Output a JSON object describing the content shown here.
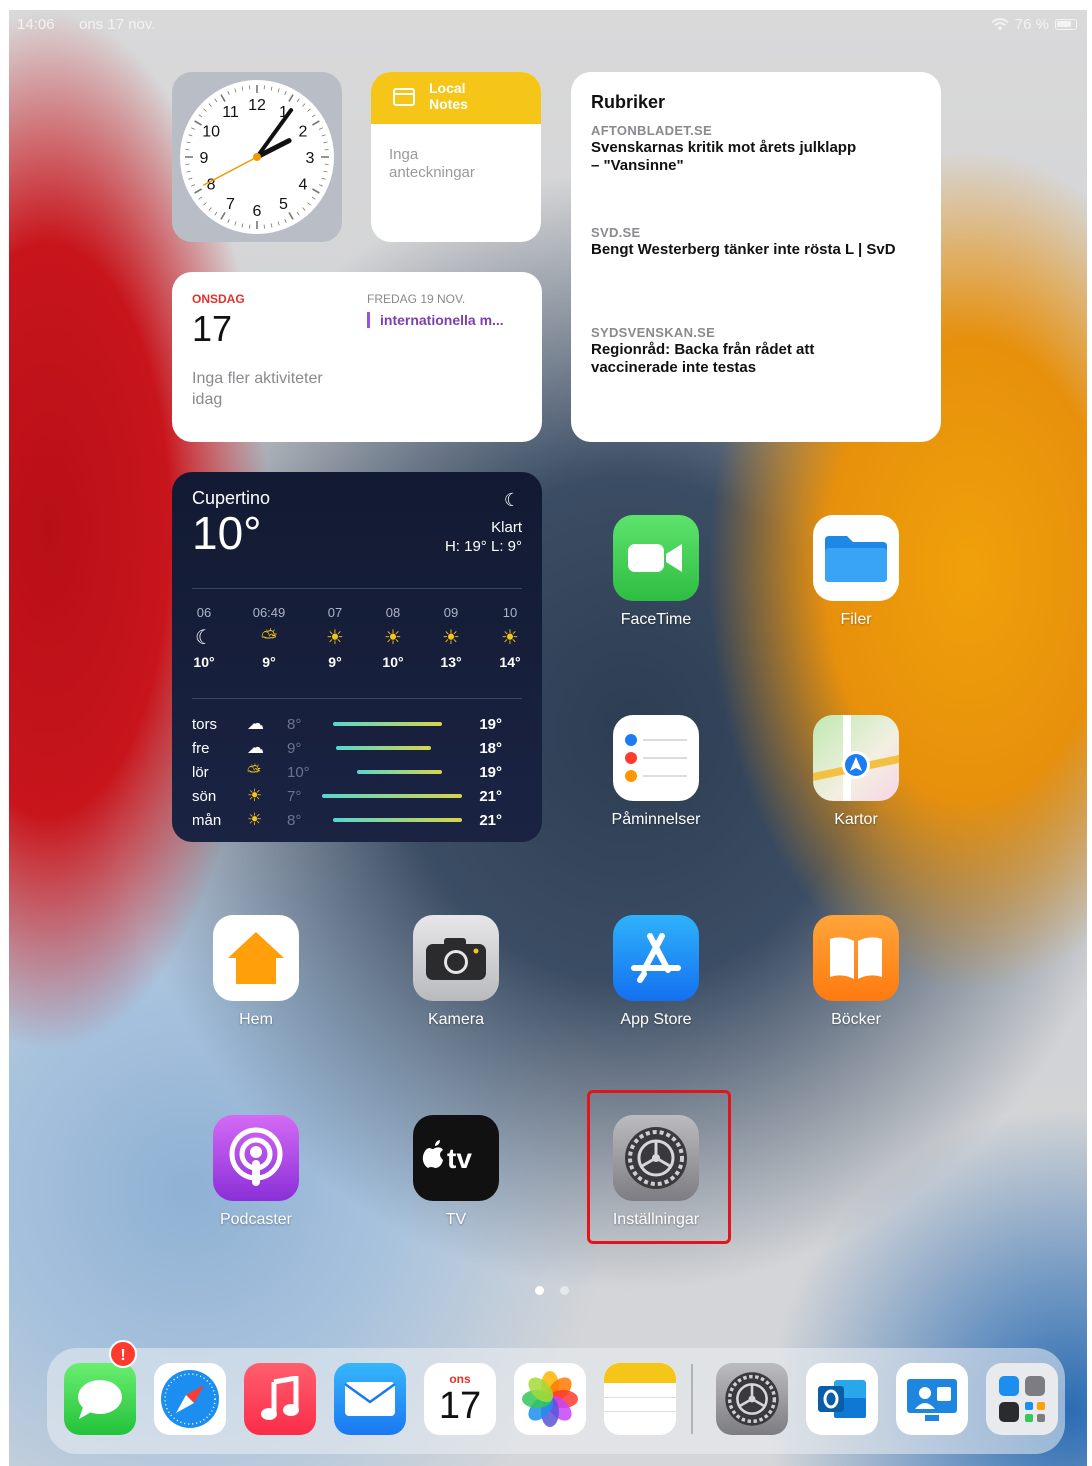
{
  "status_bar": {
    "time": "14:06",
    "date": "ons 17 nov.",
    "battery": "76 %"
  },
  "clock_widget": {
    "numbers": [
      "12",
      "1",
      "2",
      "3",
      "4",
      "5",
      "6",
      "7",
      "8",
      "9",
      "10",
      "11"
    ],
    "hour": 2,
    "minute": 6
  },
  "notes_widget": {
    "title_line1": "Local",
    "title_line2": "Notes",
    "empty_line1": "Inga",
    "empty_line2": "anteckningar"
  },
  "news_widget": {
    "title": "Rubriker",
    "items": [
      {
        "source": "AFTONBLADET.SE",
        "headline1": "Svenskarnas kritik mot årets julklapp",
        "headline2": "– \"Vansinne\""
      },
      {
        "source": "SVD.SE",
        "headline1": "Bengt Westerberg tänker inte rösta L | SvD",
        "headline2": ""
      },
      {
        "source": "SYDSVENSKAN.SE",
        "headline1": "Regionråd: Backa från rådet att",
        "headline2": "vaccinerade inte testas"
      }
    ]
  },
  "calendar_widget": {
    "weekday": "ONSDAG",
    "day": "17",
    "no_events_line1": "Inga fler aktiviteter",
    "no_events_line2": "idag",
    "next_date": "FREDAG 19 NOV.",
    "next_event": "internationella m..."
  },
  "weather_widget": {
    "city": "Cupertino",
    "temp": "10°",
    "condition": "Klart",
    "hilo": "H: 19° L: 9°",
    "hourly": [
      {
        "hour": "06",
        "icon": "moon-icon",
        "temp": "10°"
      },
      {
        "hour": "06:49",
        "icon": "sunrise-icon",
        "temp": "9°"
      },
      {
        "hour": "07",
        "icon": "sun-icon",
        "temp": "9°"
      },
      {
        "hour": "08",
        "icon": "sun-icon",
        "temp": "10°"
      },
      {
        "hour": "09",
        "icon": "sun-icon",
        "temp": "13°"
      },
      {
        "hour": "10",
        "icon": "sun-icon",
        "temp": "14°"
      }
    ],
    "daily": [
      {
        "day": "tors",
        "icon": "cloud-icon",
        "low": "8°",
        "high": "19°",
        "bar_from": 0.08,
        "bar_to": 0.86
      },
      {
        "day": "fre",
        "icon": "cloud-icon",
        "low": "9°",
        "high": "18°",
        "bar_from": 0.1,
        "bar_to": 0.78
      },
      {
        "day": "lör",
        "icon": "partly-cloudy-icon",
        "low": "10°",
        "high": "19°",
        "bar_from": 0.25,
        "bar_to": 0.86
      },
      {
        "day": "sön",
        "icon": "sun-icon",
        "low": "7°",
        "high": "21°",
        "bar_from": 0.0,
        "bar_to": 1.0
      },
      {
        "day": "mån",
        "icon": "sun-icon",
        "low": "8°",
        "high": "21°",
        "bar_from": 0.08,
        "bar_to": 1.0
      }
    ]
  },
  "apps": {
    "facetime": "FaceTime",
    "filer": "Filer",
    "paminnelser": "Påminnelser",
    "kartor": "Kartor",
    "hem": "Hem",
    "kamera": "Kamera",
    "appstore": "App Store",
    "bocker": "Böcker",
    "podcaster": "Podcaster",
    "tv": "TV",
    "installningar": "Inställningar"
  },
  "dock": {
    "messages_badge": "!",
    "calendar_weekday": "ons",
    "calendar_day": "17",
    "items": [
      "messages-icon",
      "safari-icon",
      "music-icon",
      "mail-icon",
      "calendar-icon",
      "photos-icon",
      "notes-icon",
      "settings-icon",
      "outlook-icon",
      "teams-icon",
      "app-library-icon"
    ]
  },
  "colors": {
    "highlight": "#e3141b",
    "calendar_red": "#e0322b",
    "notes_yellow": "#f5c518"
  }
}
